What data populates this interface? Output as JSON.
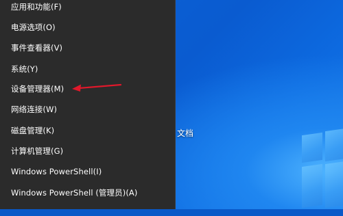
{
  "menu": {
    "items": [
      {
        "label": "应用和功能(F)"
      },
      {
        "label": "电源选项(O)"
      },
      {
        "label": "事件查看器(V)"
      },
      {
        "label": "系统(Y)"
      },
      {
        "label": "设备管理器(M)"
      },
      {
        "label": "网络连接(W)"
      },
      {
        "label": "磁盘管理(K)"
      },
      {
        "label": "计算机管理(G)"
      },
      {
        "label": "Windows PowerShell(I)"
      },
      {
        "label": "Windows PowerShell (管理员)(A)"
      }
    ]
  },
  "desktop": {
    "icon_label_fragment": "文档"
  },
  "annotation": {
    "arrow_color": "#e0182b"
  }
}
